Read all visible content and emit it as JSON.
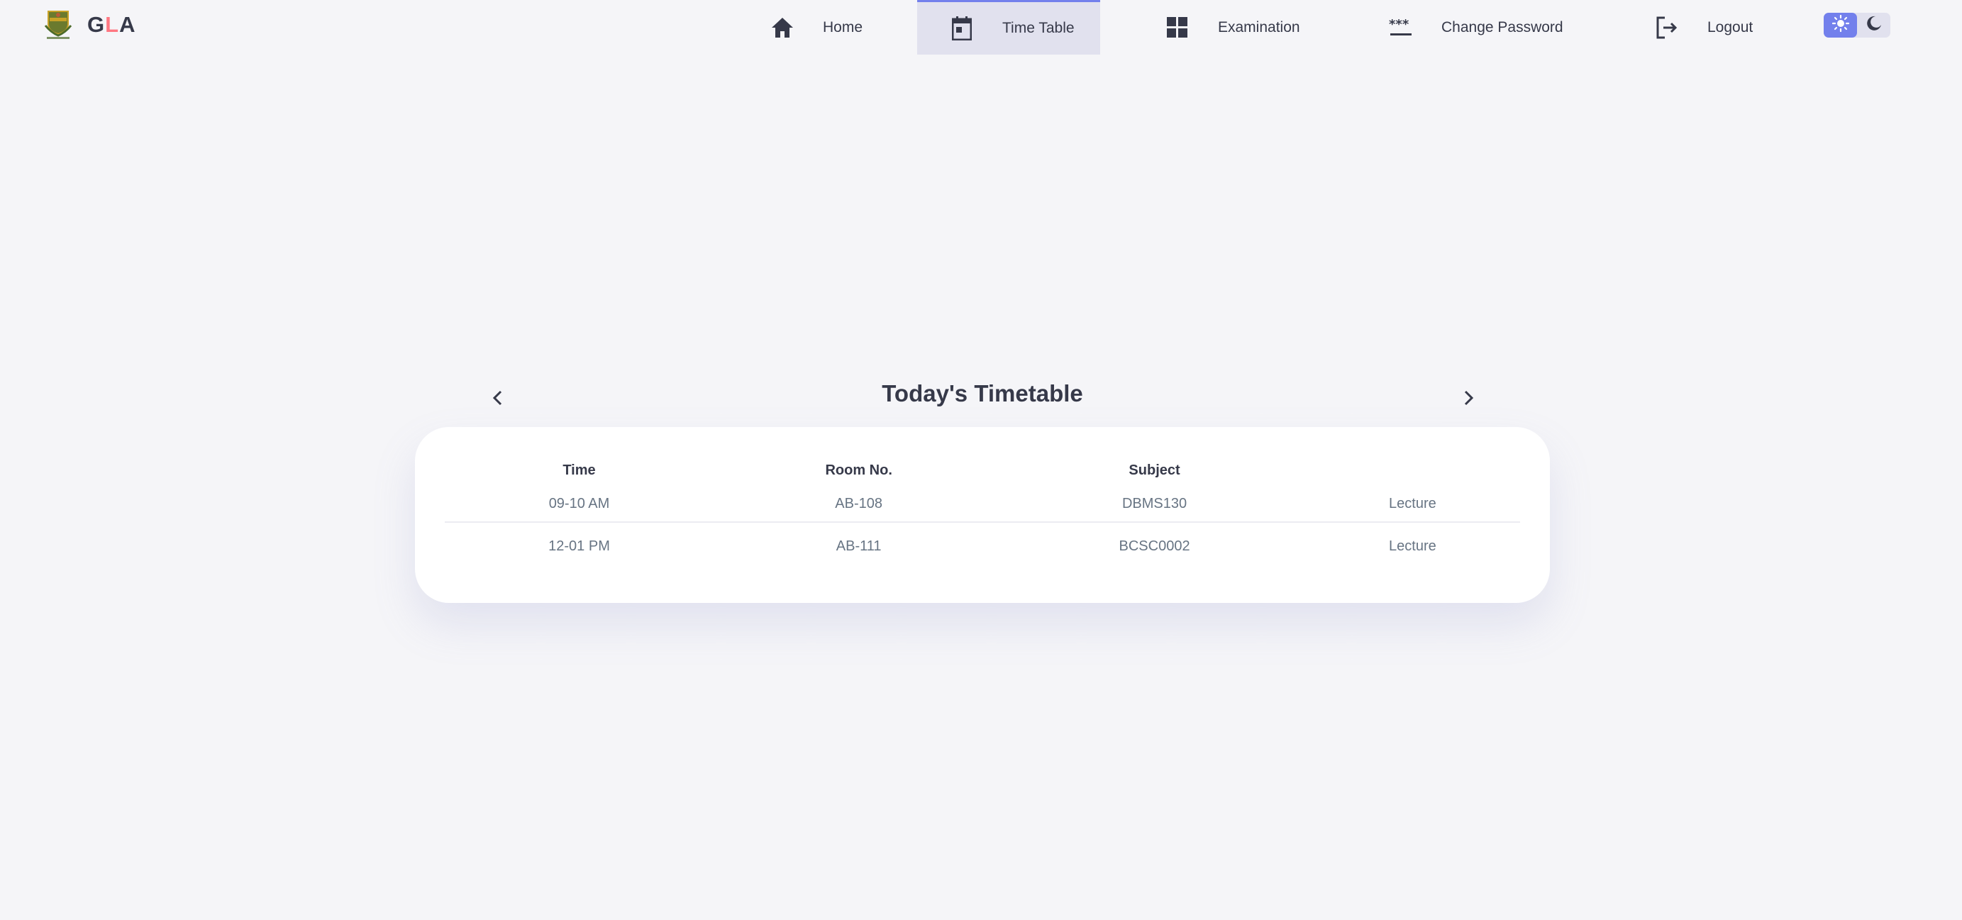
{
  "brand": {
    "letters": [
      "G",
      "L",
      "A"
    ],
    "logo_icon": "university-crest"
  },
  "nav": {
    "items": [
      {
        "label": "Home",
        "icon": "home-icon",
        "active": false
      },
      {
        "label": "Time Table",
        "icon": "calendar-icon",
        "active": true
      },
      {
        "label": "Examination",
        "icon": "grid-icon",
        "active": false
      },
      {
        "label": "Change Password",
        "icon": "password-icon",
        "active": false
      },
      {
        "label": "Logout",
        "icon": "logout-icon",
        "active": false
      }
    ],
    "theme": {
      "options": [
        "light",
        "dark"
      ],
      "selected": "light"
    }
  },
  "colors": {
    "accent": "#7380ec",
    "active_bg": "#e1e1ee",
    "brand_red": "#ff7782",
    "text_dark": "#363949",
    "text_muted": "#677483",
    "page_bg": "#f5f5f8"
  },
  "timetable": {
    "title": "Today's Timetable",
    "prev_icon": "chevron-left-icon",
    "next_icon": "chevron-right-icon",
    "headers": [
      "Time",
      "Room No.",
      "Subject",
      ""
    ],
    "rows": [
      [
        "09-10 AM",
        "AB-108",
        "DBMS130",
        "Lecture"
      ],
      [
        "12-01 PM",
        "AB-111",
        "BCSC0002",
        "Lecture"
      ]
    ]
  }
}
